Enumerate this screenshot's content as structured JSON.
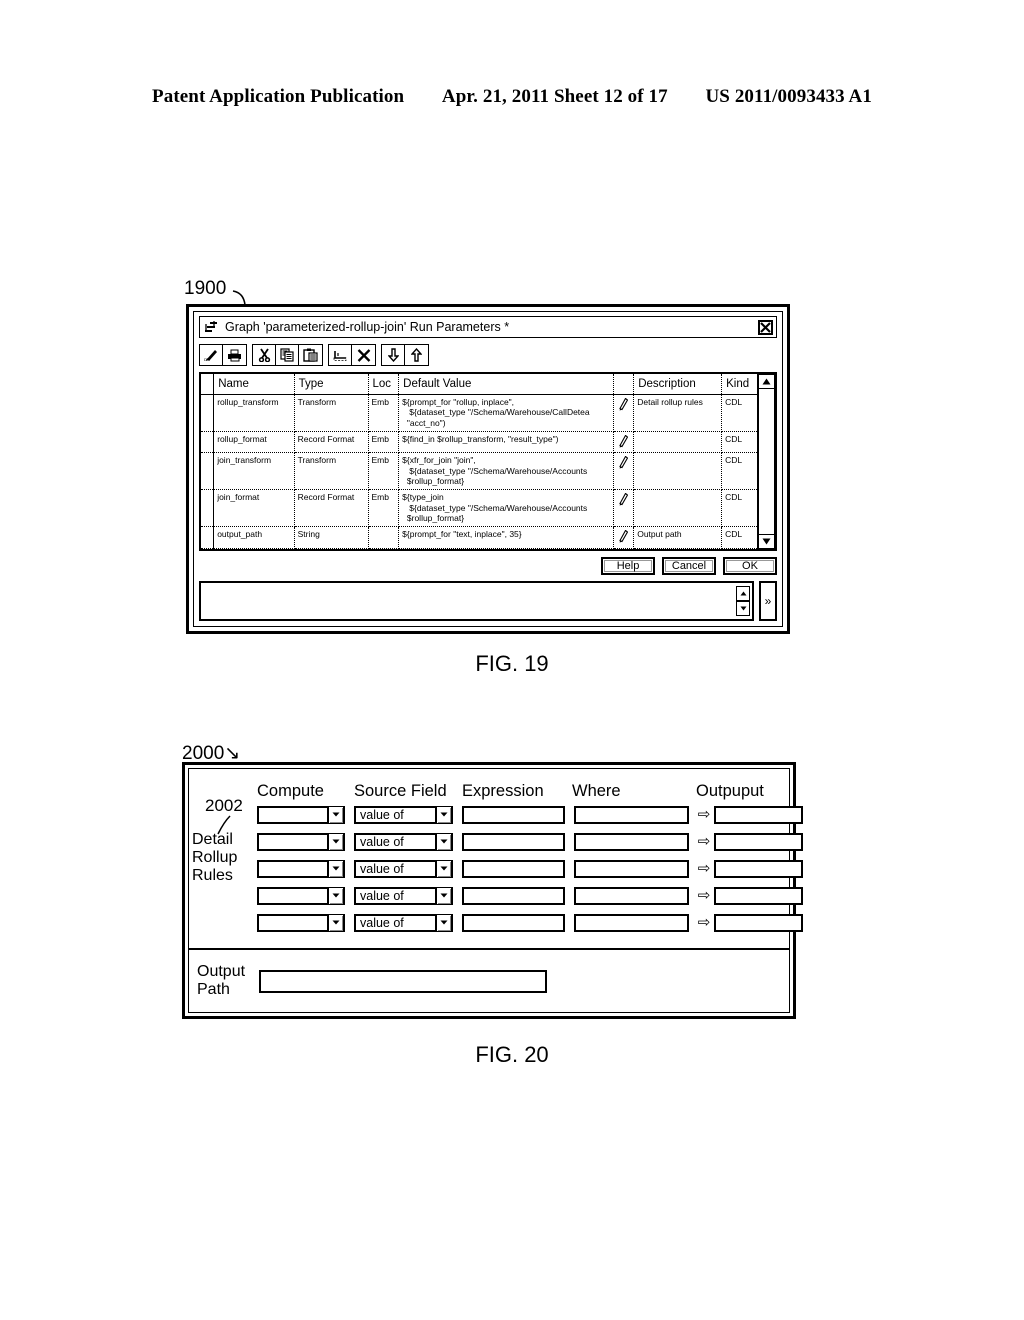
{
  "page_header": {
    "publication": "Patent Application Publication",
    "date_sheet": "Apr. 21, 2011  Sheet 12 of 17",
    "patent_number": "US 2011/0093433 A1"
  },
  "figures": [
    {
      "caption": "FIG. 19",
      "ref_numeral": "1900"
    },
    {
      "caption": "FIG. 20",
      "ref_numeral": "2000"
    }
  ],
  "fig19": {
    "ref_numeral": "1900",
    "caption": "FIG. 19",
    "titlebar": {
      "icon": "graph-app-icon",
      "title": "Graph 'parameterized-rollup-join' Run Parameters *",
      "close_icon": "close-box-icon"
    },
    "toolbar": {
      "groups": [
        [
          {
            "icon": "edit-script-icon",
            "name": "edit-script-button"
          },
          {
            "icon": "print-icon",
            "name": "print-button"
          }
        ],
        [
          {
            "icon": "scissors-icon",
            "name": "cut-button"
          },
          {
            "icon": "copy-icon",
            "name": "copy-button"
          },
          {
            "icon": "paste-icon",
            "name": "paste-button"
          }
        ],
        [
          {
            "icon": "insert-row-icon",
            "name": "insert-row-button"
          },
          {
            "icon": "delete-x-icon",
            "name": "delete-row-button"
          }
        ],
        [
          {
            "icon": "arrow-down-icon",
            "name": "move-down-button"
          },
          {
            "icon": "arrow-up-icon",
            "name": "move-up-button"
          }
        ]
      ]
    },
    "table": {
      "columns": [
        "Name",
        "Type",
        "Loc",
        "Default Value",
        "",
        "Description",
        "Kind"
      ],
      "rows": [
        {
          "name": "rollup_transform",
          "type": "Transform",
          "loc": "Emb",
          "default_value": "${prompt_for \"rollup, inplace\",\n   ${dataset_type \"/Schema/Warehouse/CallDetea\n  \"acct_no\")",
          "edit_icon": "pencil-icon",
          "description": "Detail rollup rules",
          "kind": "CDL"
        },
        {
          "name": "rollup_format",
          "type": "Record Format",
          "loc": "Emb",
          "default_value": "${find_in $rollup_transform, \"result_type\")",
          "edit_icon": "pencil-icon",
          "description": "",
          "kind": "CDL"
        },
        {
          "name": "join_transform",
          "type": "Transform",
          "loc": "Emb",
          "default_value": "${xfr_for_join \"join\",\n   ${dataset_type \"/Schema/Warehouse/Accounts\n  $rollup_format}",
          "edit_icon": "pencil-icon",
          "description": "",
          "kind": "CDL"
        },
        {
          "name": "join_format",
          "type": "Record Format",
          "loc": "Emb",
          "default_value": "${type_join\n   ${dataset_type \"/Schema/Warehouse/Accounts\n  $rollup_format}",
          "edit_icon": "pencil-icon",
          "description": "",
          "kind": "CDL"
        },
        {
          "name": "output_path",
          "type": "String",
          "loc": "",
          "default_value": "${prompt_for \"text, inplace\", 35}",
          "edit_icon": "pencil-icon",
          "description": "Output path",
          "kind": "CDL"
        }
      ],
      "scrollbar": {
        "up_icon": "scroll-up-icon",
        "down_icon": "scroll-down-icon"
      }
    },
    "buttons": [
      {
        "label": "Help",
        "name": "help-button"
      },
      {
        "label": "Cancel",
        "name": "cancel-button"
      },
      {
        "label": "OK",
        "name": "ok-button"
      }
    ],
    "status_bar": {
      "value": "",
      "spinner_up_icon": "spinner-up-icon",
      "spinner_down_icon": "spinner-down-icon",
      "expand_label": "»"
    }
  },
  "fig20": {
    "ref_numeral": "2000",
    "caption": "FIG. 20",
    "rules_ref_numeral": "2002",
    "side_label": "Detail\nRollup\nRules",
    "side_label_lines": [
      "Detail",
      "Rollup",
      "Rules"
    ],
    "columns": [
      "Compute",
      "Source Field",
      "Expression",
      "Where",
      "Outpuput"
    ],
    "arrow_glyph": "⇨",
    "dropdown_icon": "chevron-down-icon",
    "rows": [
      {
        "compute": "",
        "source_field": "value of",
        "expression": "",
        "where": "",
        "output": ""
      },
      {
        "compute": "",
        "source_field": "value of",
        "expression": "",
        "where": "",
        "output": ""
      },
      {
        "compute": "",
        "source_field": "value of",
        "expression": "",
        "where": "",
        "output": ""
      },
      {
        "compute": "",
        "source_field": "value of",
        "expression": "",
        "where": "",
        "output": ""
      },
      {
        "compute": "",
        "source_field": "value of",
        "expression": "",
        "where": "",
        "output": ""
      }
    ],
    "output_path": {
      "label_lines": [
        "Output",
        "Path"
      ],
      "value": ""
    }
  }
}
